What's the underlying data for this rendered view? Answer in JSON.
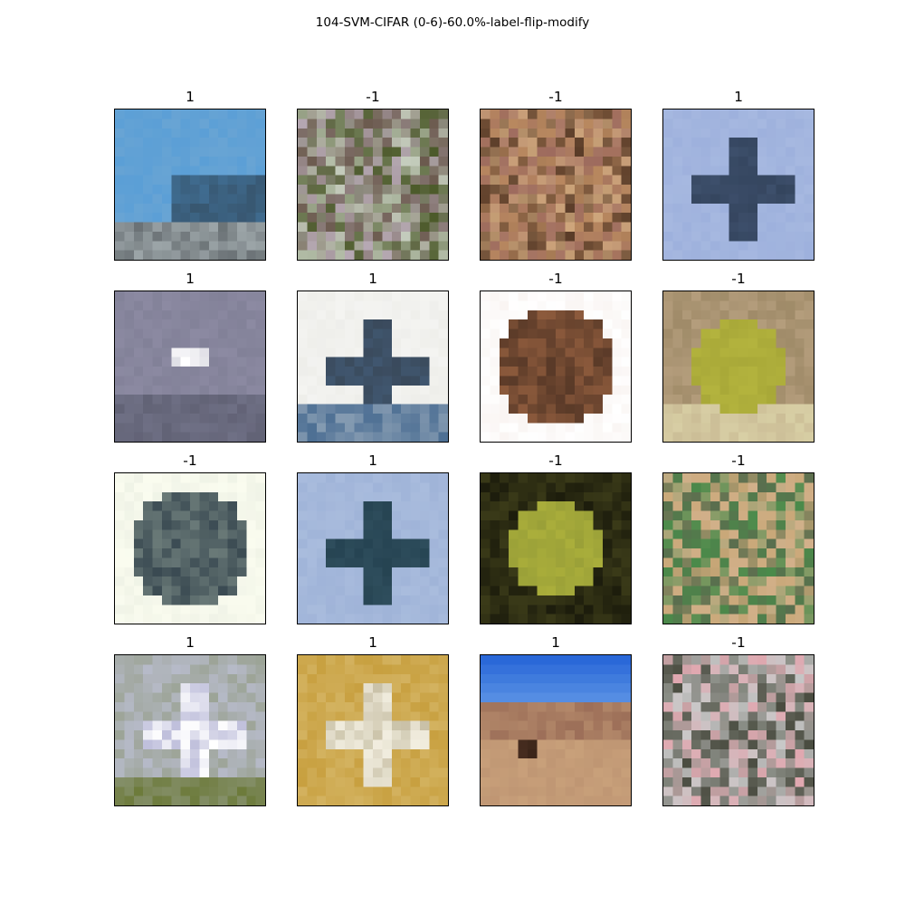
{
  "title": "104-SVM-CIFAR (0-6)-60.0%-label-flip-modify",
  "panels": [
    {
      "label": "1",
      "scene": "ship-sky",
      "colors": [
        "#5b9fd6",
        "#3f6b8f",
        "#2a2f33",
        "#b9c3c6"
      ]
    },
    {
      "label": "-1",
      "scene": "frog-texture",
      "colors": [
        "#b7a9b4",
        "#4c5a2a",
        "#6b5a4e",
        "#c7cfc0"
      ]
    },
    {
      "label": "-1",
      "scene": "frog-texture",
      "colors": [
        "#b8885f",
        "#5a3c28",
        "#9d6a5e",
        "#cfa77c"
      ]
    },
    {
      "label": "1",
      "scene": "airplane-sky",
      "colors": [
        "#a6b8e0",
        "#3d4f6b",
        "#243246",
        "#8fa4d6"
      ]
    },
    {
      "label": "1",
      "scene": "bird-gray",
      "colors": [
        "#8c8aa2",
        "#6f7085",
        "#ffffff",
        "#30303c"
      ]
    },
    {
      "label": "1",
      "scene": "airplane-water",
      "colors": [
        "#eeeeea",
        "#3a4a5c",
        "#4c6e93",
        "#ffffff"
      ]
    },
    {
      "label": "-1",
      "scene": "frog-white",
      "colors": [
        "#ffffff",
        "#8c5a3c",
        "#5a3a28",
        "#caa08c"
      ]
    },
    {
      "label": "-1",
      "scene": "frog-green",
      "colors": [
        "#b49d7c",
        "#a8a838",
        "#d8cfa5",
        "#7a6a45"
      ]
    },
    {
      "label": "-1",
      "scene": "frog-white",
      "colors": [
        "#fafcef",
        "#3a4a52",
        "#6a7a78",
        "#9aa8a0"
      ]
    },
    {
      "label": "1",
      "scene": "airplane-sky",
      "colors": [
        "#a9bcdd",
        "#2e4d5c",
        "#16323f",
        "#8ea4cf"
      ]
    },
    {
      "label": "-1",
      "scene": "frog-dark",
      "colors": [
        "#3a3a18",
        "#9aa038",
        "#c8c840",
        "#1c1c0c"
      ]
    },
    {
      "label": "-1",
      "scene": "frog-texture",
      "colors": [
        "#c9a878",
        "#5a6e4e",
        "#d2b08a",
        "#4a8a4a"
      ]
    },
    {
      "label": "1",
      "scene": "airplane-ground",
      "colors": [
        "#b6bac8",
        "#ffffff",
        "#4a4a9a",
        "#6c7a3a"
      ]
    },
    {
      "label": "1",
      "scene": "airplane-yellow",
      "colors": [
        "#c8a040",
        "#f2eee0",
        "#7a6a3a",
        "#e8d49a"
      ]
    },
    {
      "label": "1",
      "scene": "desert",
      "colors": [
        "#2a68d8",
        "#c8a07a",
        "#3a2418",
        "#8a5a4a"
      ]
    },
    {
      "label": "-1",
      "scene": "frog-texture",
      "colors": [
        "#8c9088",
        "#e0a8b0",
        "#4a4c40",
        "#c8c8c8"
      ]
    }
  ]
}
